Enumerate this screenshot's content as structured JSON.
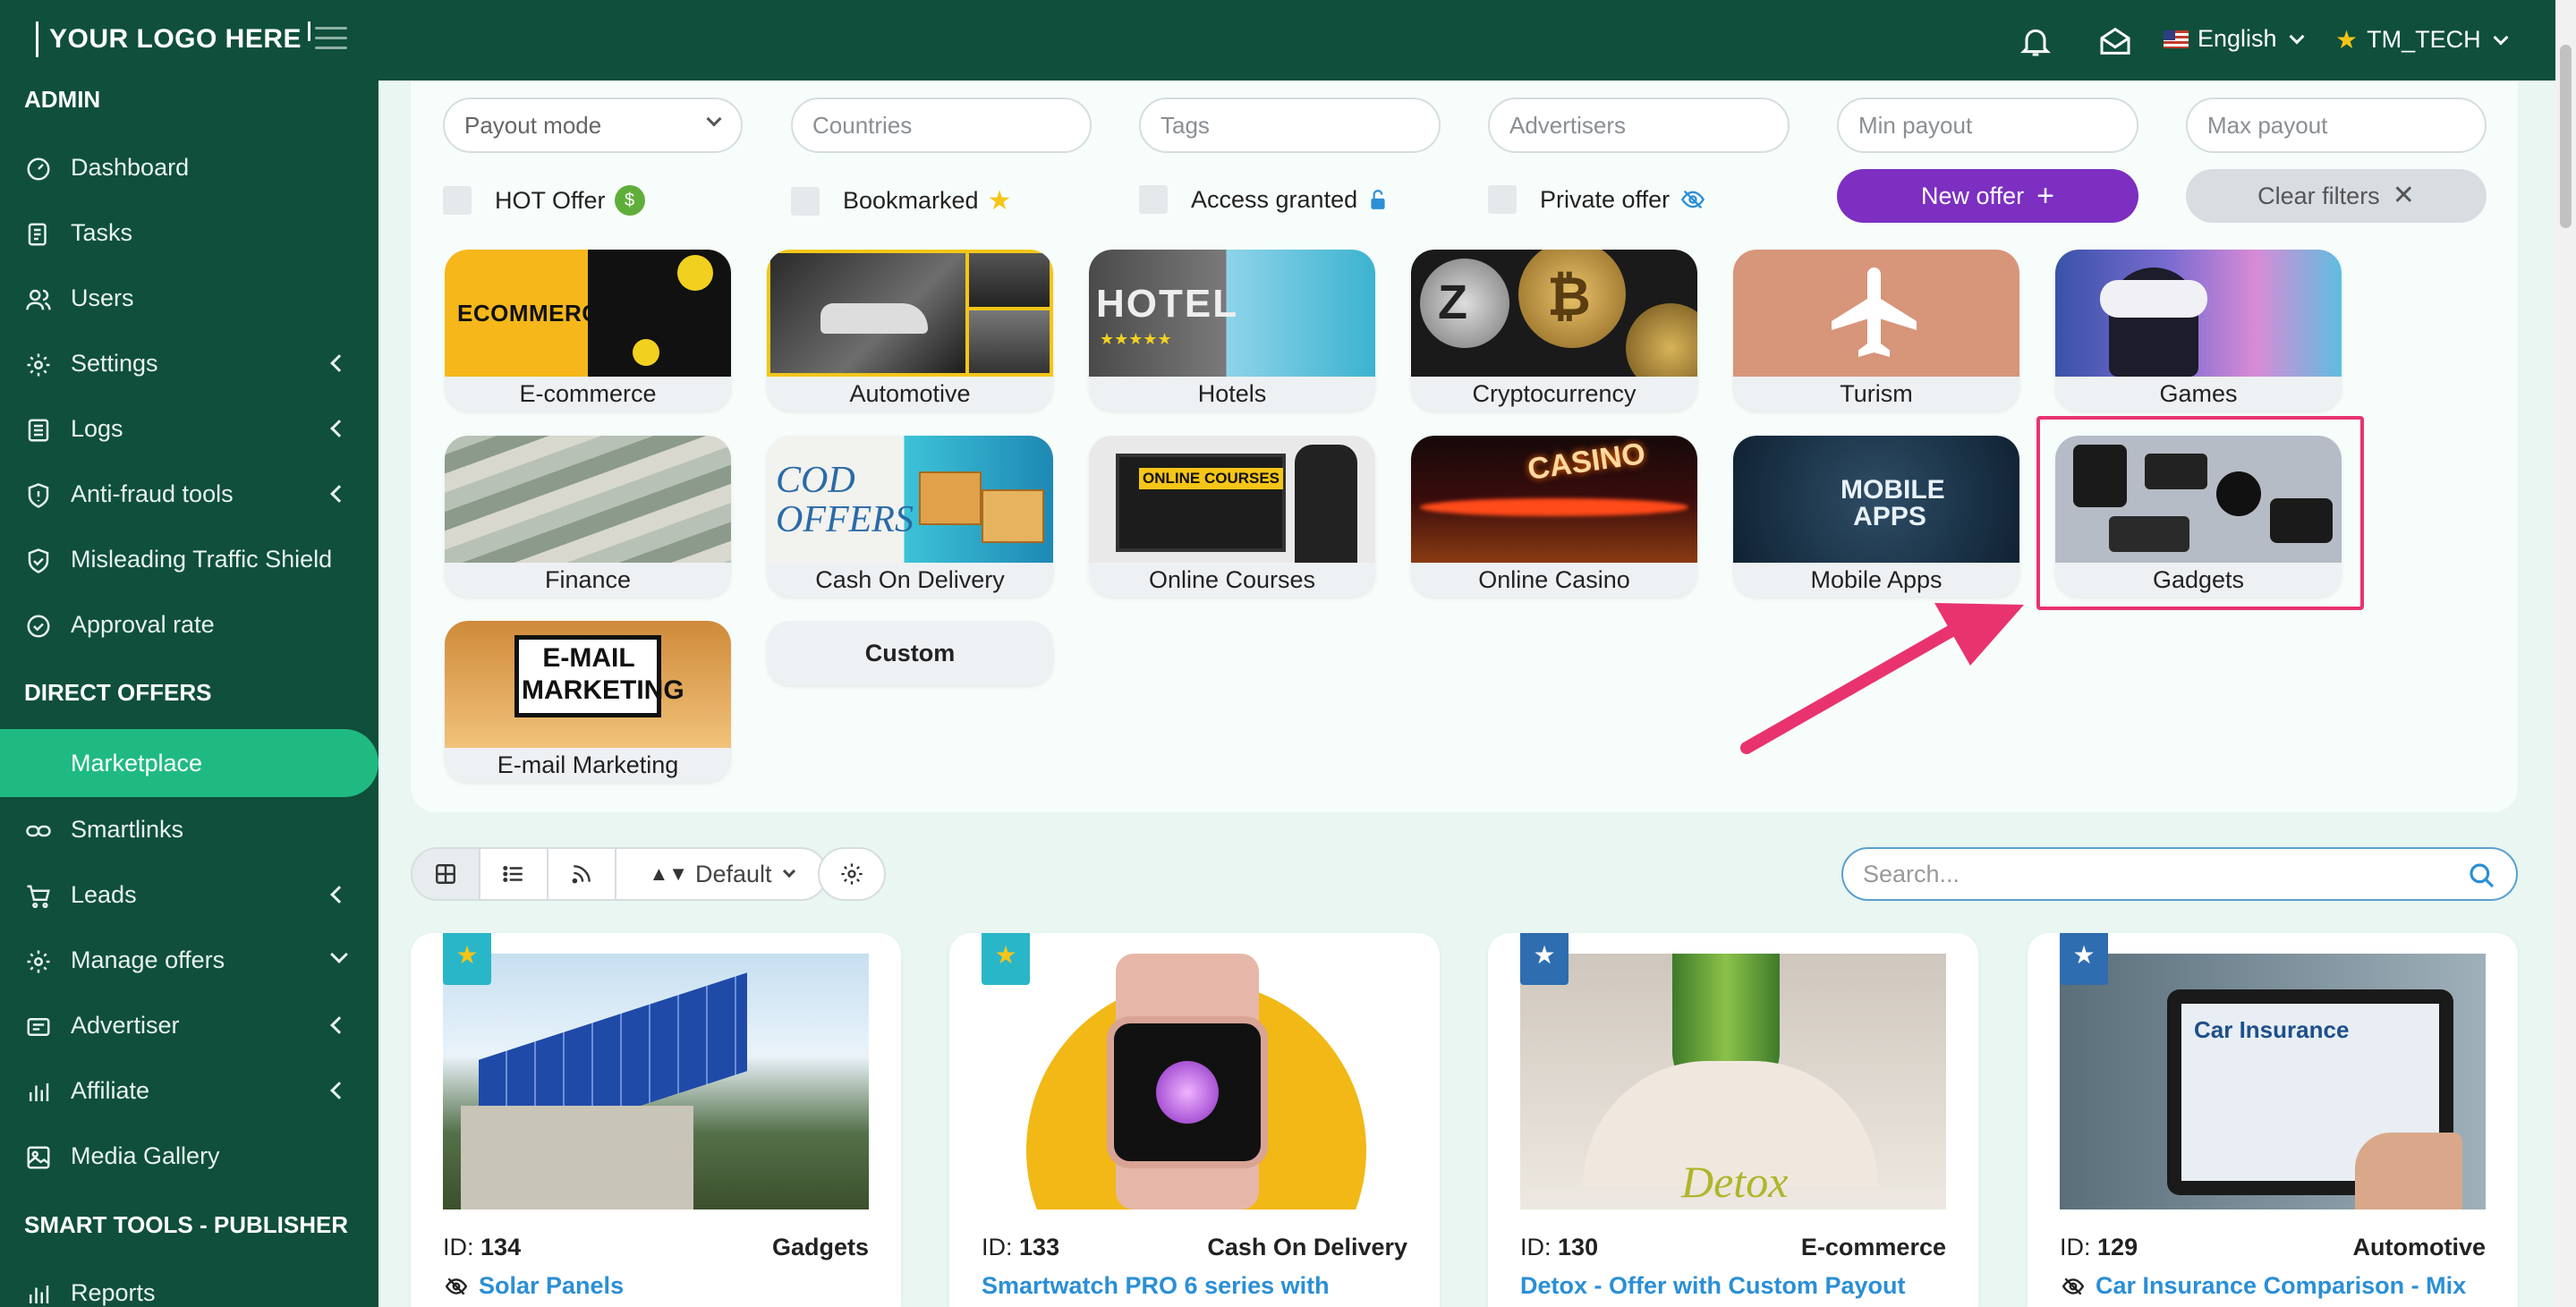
{
  "header": {
    "logo": "YOUR LOGO HERE",
    "language": "English",
    "user": "TM_TECH",
    "icons": [
      "menu-icon",
      "bell-icon",
      "envelope-icon",
      "us-flag-icon",
      "star-icon"
    ]
  },
  "sidebar": {
    "section_admin": "ADMIN",
    "section_direct": "DIRECT OFFERS",
    "section_smart": "SMART TOOLS - PUBLISHER",
    "items": [
      {
        "label": "Dashboard"
      },
      {
        "label": "Tasks"
      },
      {
        "label": "Users"
      },
      {
        "label": "Settings"
      },
      {
        "label": "Logs"
      },
      {
        "label": "Anti-fraud tools"
      },
      {
        "label": "Misleading Traffic Shield"
      },
      {
        "label": "Approval rate"
      },
      {
        "label": "Marketplace"
      },
      {
        "label": "Smartlinks"
      },
      {
        "label": "Leads"
      },
      {
        "label": "Manage offers"
      },
      {
        "label": "Advertiser"
      },
      {
        "label": "Affiliate"
      },
      {
        "label": "Media Gallery"
      },
      {
        "label": "Reports"
      }
    ]
  },
  "filters": {
    "payout_mode": "Payout mode",
    "countries": "Countries",
    "tags": "Tags",
    "advertisers": "Advertisers",
    "min_payout": "Min payout",
    "max_payout": "Max payout",
    "hot_offer": "HOT Offer",
    "bookmarked": "Bookmarked",
    "access_granted": "Access granted",
    "private_offer": "Private offer",
    "new_offer": "New offer",
    "clear_filters": "Clear filters"
  },
  "categories": [
    {
      "label": "E-commerce",
      "img_text": "ECOMMERCE OFFERS"
    },
    {
      "label": "Automotive"
    },
    {
      "label": "Hotels",
      "img_text": "HOTEL"
    },
    {
      "label": "Cryptocurrency"
    },
    {
      "label": "Turism"
    },
    {
      "label": "Games"
    },
    {
      "label": "Finance"
    },
    {
      "label": "Cash On Delivery",
      "img_text": "COD OFFERS"
    },
    {
      "label": "Online Courses",
      "img_text": "ONLINE COURSES"
    },
    {
      "label": "Online Casino",
      "img_text": "CASINO"
    },
    {
      "label": "Mobile Apps",
      "img_text": "MOBILE APPS"
    },
    {
      "label": "Gadgets"
    },
    {
      "label": "E-mail Marketing",
      "img_text": "E-MAIL MARKETING"
    },
    {
      "label": "Custom"
    }
  ],
  "toolbar": {
    "sort": "Default",
    "search_placeholder": "Search..."
  },
  "offers": [
    {
      "id_label": "ID:",
      "id": "134",
      "category": "Gadgets",
      "title": "Solar Panels",
      "star_color": "#29b6c8",
      "private": true
    },
    {
      "id_label": "ID:",
      "id": "133",
      "category": "Cash On Delivery",
      "title": "Smartwatch PRO 6 series with",
      "star_color": "#29b6c8",
      "private": false
    },
    {
      "id_label": "ID:",
      "id": "130",
      "category": "E-commerce",
      "title": "Detox - Offer with Custom Payout",
      "star_color": "#2d6db0",
      "private": false,
      "img_text": "Detox"
    },
    {
      "id_label": "ID:",
      "id": "129",
      "category": "Automotive",
      "title": "Car Insurance Comparison - Mix",
      "star_color": "#2d6db0",
      "private": true,
      "img_text": "Car Insurance"
    }
  ],
  "colors": {
    "sidebar": "#0f4f3c",
    "active": "#1fba82",
    "accent_purple": "#7c2fc0",
    "highlight": "#e8336f",
    "link": "#2b8fd6"
  }
}
